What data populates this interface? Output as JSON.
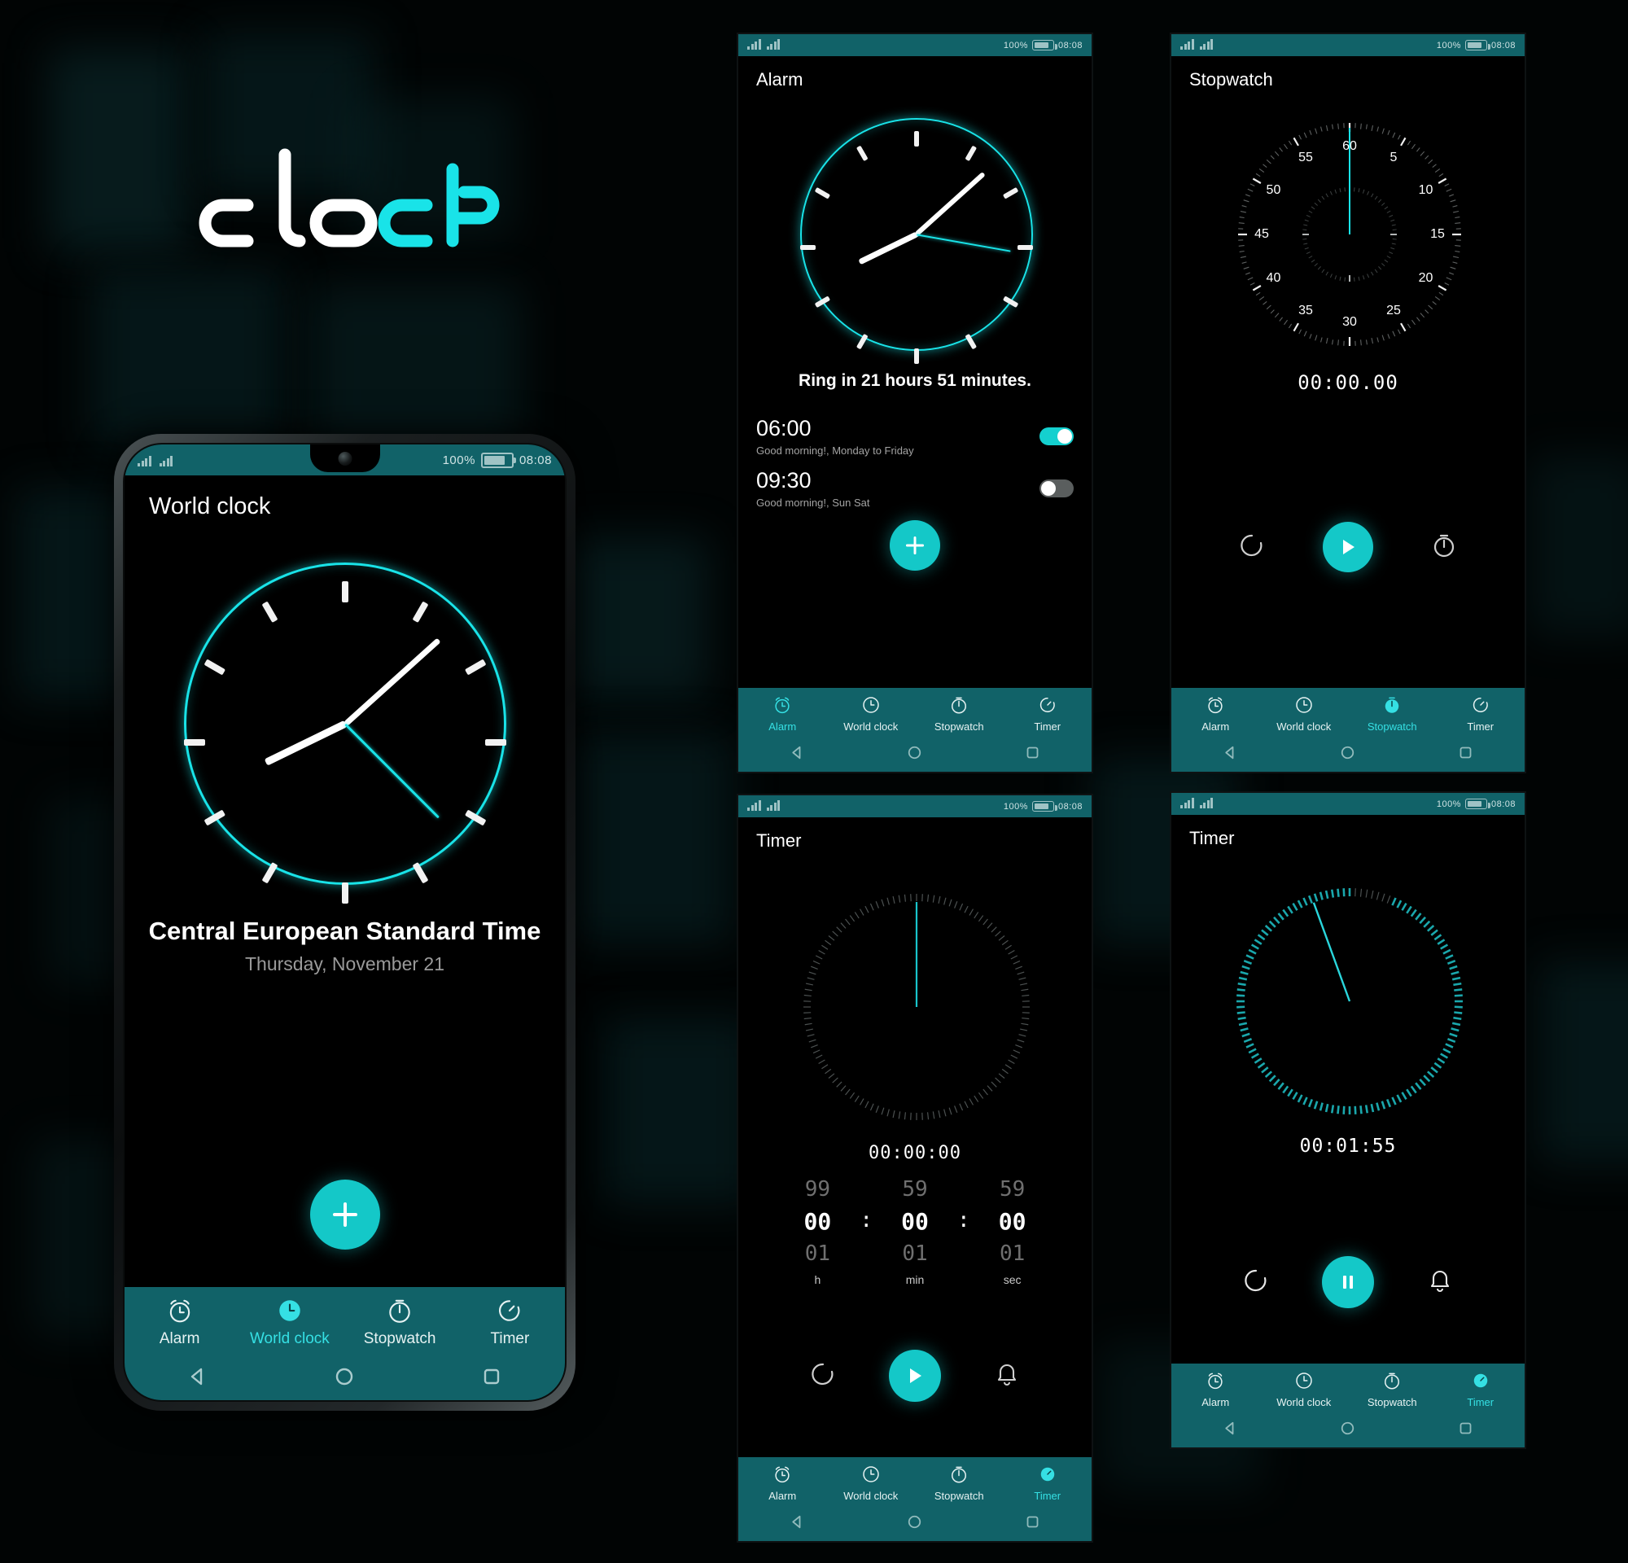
{
  "app": {
    "logo_text": "clock",
    "logo_white_part": "cloc",
    "logo_accent_part": "k",
    "accent_color": "#19e3e8",
    "teal_bar_color": "#116268",
    "fab_color": "#14c8c8"
  },
  "status_bar": {
    "battery_percent": "100%",
    "time": "08:08"
  },
  "nav": {
    "items": [
      {
        "label": "Alarm",
        "icon": "alarm-clock-icon"
      },
      {
        "label": "World clock",
        "icon": "clock-icon"
      },
      {
        "label": "Stopwatch",
        "icon": "stopwatch-icon"
      },
      {
        "label": "Timer",
        "icon": "timer-icon"
      }
    ],
    "system_keys": [
      "back-triangle-icon",
      "home-circle-icon",
      "recents-square-icon"
    ]
  },
  "screens": {
    "world_clock": {
      "title": "World clock",
      "active_tab": "World clock",
      "timezone_name": "Central European Standard Time",
      "date": "Thursday, November 21",
      "clock": {
        "hour_deg": 244,
        "minute_deg": 48,
        "second_deg": 135
      },
      "add_button_label": "+"
    },
    "alarm": {
      "title": "Alarm",
      "active_tab": "Alarm",
      "ring_note": "Ring in 21 hours 51 minutes.",
      "clock": {
        "hour_deg": 244,
        "minute_deg": 48,
        "second_deg": 100
      },
      "alarms": [
        {
          "time": "06:00",
          "note": "Good morning!, Monday to Friday",
          "enabled": true
        },
        {
          "time": "09:30",
          "note": "Good morning!, Sun Sat",
          "enabled": false
        }
      ],
      "add_button_label": "+"
    },
    "stopwatch": {
      "title": "Stopwatch",
      "active_tab": "Stopwatch",
      "elapsed": "00:00.00",
      "dial_numbers": [
        "60",
        "5",
        "10",
        "15",
        "20",
        "25",
        "30",
        "35",
        "40",
        "45",
        "50",
        "55"
      ],
      "controls": [
        {
          "name": "reset",
          "icon": "reset-arrow-icon"
        },
        {
          "name": "start",
          "icon": "play-icon"
        },
        {
          "name": "lap",
          "icon": "stopwatch-icon"
        }
      ]
    },
    "timer_idle": {
      "title": "Timer",
      "active_tab": "Timer",
      "display": "00:00:00",
      "picker": {
        "hours": {
          "prev": "99",
          "value": "00",
          "next": "01",
          "unit": "h"
        },
        "minutes": {
          "prev": "59",
          "value": "00",
          "next": "01",
          "unit": "min"
        },
        "seconds": {
          "prev": "59",
          "value": "00",
          "next": "01",
          "unit": "sec"
        },
        "separator": ":"
      },
      "controls": [
        {
          "name": "reset",
          "icon": "reset-arrow-icon"
        },
        {
          "name": "start",
          "icon": "play-icon"
        },
        {
          "name": "alarm-sound",
          "icon": "bell-icon"
        }
      ]
    },
    "timer_running": {
      "title": "Timer",
      "active_tab": "Timer",
      "display": "00:01:55",
      "progress_percent": 94,
      "hand_deg": 340,
      "controls": [
        {
          "name": "reset",
          "icon": "reset-arrow-icon"
        },
        {
          "name": "pause",
          "icon": "pause-icon"
        },
        {
          "name": "alarm-sound",
          "icon": "bell-icon"
        }
      ]
    }
  }
}
